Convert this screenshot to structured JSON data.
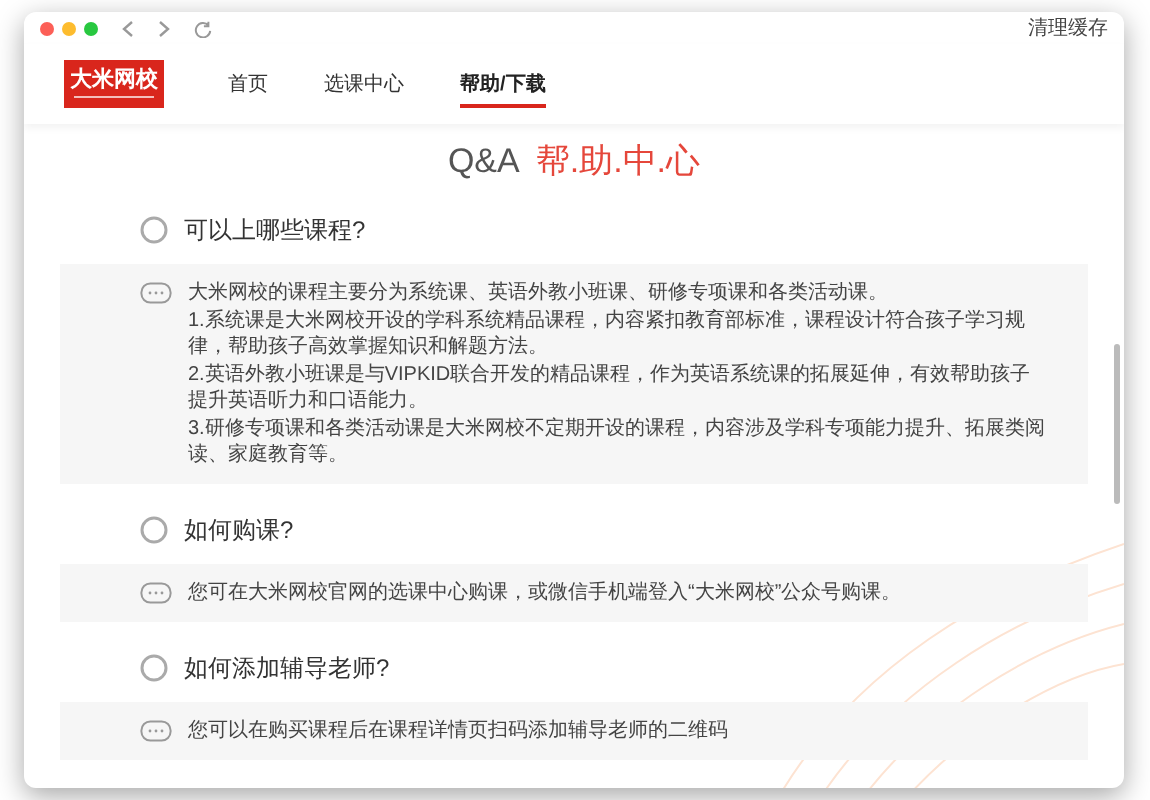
{
  "toolbar": {
    "link": "清理缓存"
  },
  "logo": {
    "text": "大米网校"
  },
  "nav": [
    {
      "label": "首页",
      "selected": false
    },
    {
      "label": "选课中心",
      "selected": false
    },
    {
      "label": "帮助/下载",
      "selected": true
    }
  ],
  "heading": {
    "prefix": "Q&A",
    "title": "帮.助.中.心"
  },
  "faqs": [
    {
      "question": "可以上哪些课程?",
      "answer": [
        "大米网校的课程主要分为系统课、英语外教小班课、研修专项课和各类活动课。",
        "1.系统课是大米网校开设的学科系统精品课程，内容紧扣教育部标准，课程设计符合孩子学习规律，帮助孩子高效掌握知识和解题方法。",
        "2.英语外教小班课是与VIPKID联合开发的精品课程，作为英语系统课的拓展延伸，有效帮助孩子提升英语听力和口语能力。",
        "3.研修专项课和各类活动课是大米网校不定期开设的课程，内容涉及学科专项能力提升、拓展类阅读、家庭教育等。"
      ]
    },
    {
      "question": "如何购课?",
      "answer": [
        "您可在大米网校官网的选课中心购课，或微信手机端登入“大米网校”公众号购课。"
      ]
    },
    {
      "question": "如何添加辅导老师?",
      "answer": [
        "您可以在购买课程后在课程详情页扫码添加辅导老师的二维码"
      ]
    }
  ]
}
